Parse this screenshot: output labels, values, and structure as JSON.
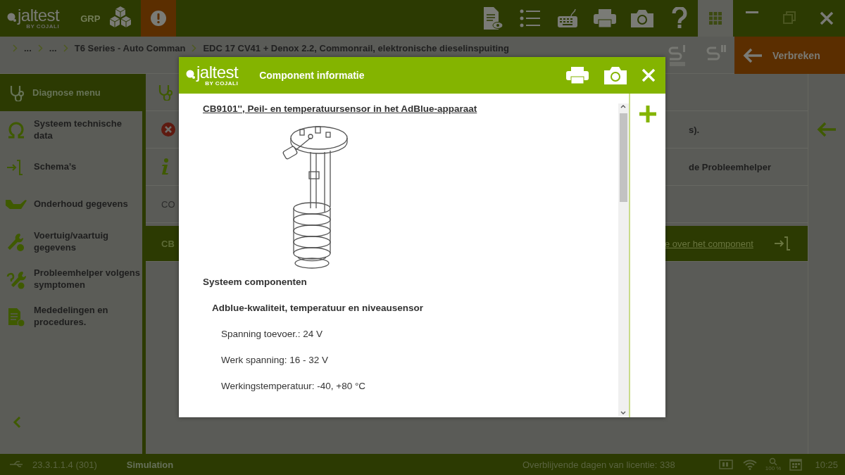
{
  "top_bar": {
    "logo": {
      "name": "jaltest",
      "byline": "BY COJALI"
    },
    "group": "GRP"
  },
  "breadcrumb": {
    "items": [
      "...",
      "...",
      "T6 Series - Auto Comman",
      "EDC 17 CV41 + Denox 2.2, Commonrail, elektronische dieselinspuiting"
    ],
    "disconnect_button": "Verbreken"
  },
  "sidebar": {
    "header": "Diagnose menu",
    "items": [
      {
        "label": "Systeem technische data"
      },
      {
        "label": "Schema’s"
      },
      {
        "label": "Onderhoud gegevens"
      },
      {
        "label": "Voertuig/vaartuig gegevens"
      },
      {
        "label": "Probleemhelper volgens symptomen"
      },
      {
        "label": "Mededelingen en procedures."
      }
    ]
  },
  "main": {
    "rows": [
      {
        "kind": "error",
        "left": "",
        "right": "s).",
        "selected": false
      },
      {
        "kind": "info",
        "left": "",
        "right": "de Probleemhelper",
        "selected": false
      },
      {
        "kind": "plain",
        "left": "CO",
        "right": "",
        "selected": false
      },
      {
        "kind": "link",
        "left": "CB",
        "right": "e over het component",
        "selected": true
      }
    ]
  },
  "modal": {
    "logo": {
      "name": "jaltest",
      "byline": "BY COJALI"
    },
    "title": "Component informatie",
    "heading": "CB9101'', Peil- en temperatuursensor in het AdBlue-apparaat",
    "section": "Systeem componenten",
    "component": "Adblue-kwaliteit, temperatuur en niveausensor",
    "specs": [
      "Spanning toevoer.: 24 V",
      "Werk spanning: 16 - 32 V",
      "Werkingstemperatuur: -40, +80 °C"
    ]
  },
  "status_bar": {
    "version": "23.3.1.1.4 (301)",
    "mode": "Simulation",
    "license": "Overblijvende dagen van licentie: 338",
    "zoom": "100 %",
    "time": "10:25"
  }
}
